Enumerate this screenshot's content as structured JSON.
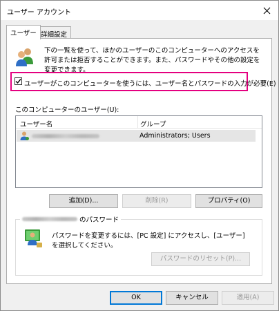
{
  "window": {
    "title": "ユーザー アカウント"
  },
  "tabs": [
    {
      "label": "ユーザー"
    },
    {
      "label": "詳細設定"
    }
  ],
  "intro": {
    "text": "下の一覧を使って、ほかのユーザーのこのコンピューターへのアクセスを許可または拒否することができます。また、パスワードやその他の設定を変更できます。"
  },
  "require_login": {
    "label": "ユーザーがこのコンピューターを使うには、ユーザー名とパスワードの入力が必要(E)",
    "checked": true
  },
  "users": {
    "label": "このコンピューターのユーザー(U):",
    "columns": [
      "ユーザー名",
      "グループ"
    ],
    "rows": [
      {
        "group": "Administrators; Users"
      }
    ]
  },
  "buttons": {
    "add": "追加(D)...",
    "remove": "削除(R)",
    "properties": "プロパティ(O)",
    "reset_password": "パスワードのリセット(P)...",
    "ok": "OK",
    "cancel": "キャンセル",
    "apply": "適用(A)"
  },
  "password_group": {
    "title_suffix": "のパスワード",
    "text": "パスワードを変更するには、[PC 設定] にアクセスし、[ユーザー] を選択してください。"
  },
  "colors": {
    "highlight_border": "#e4007f",
    "default_button_border": "#0078d7",
    "selected_row": "#e5e5e5"
  }
}
